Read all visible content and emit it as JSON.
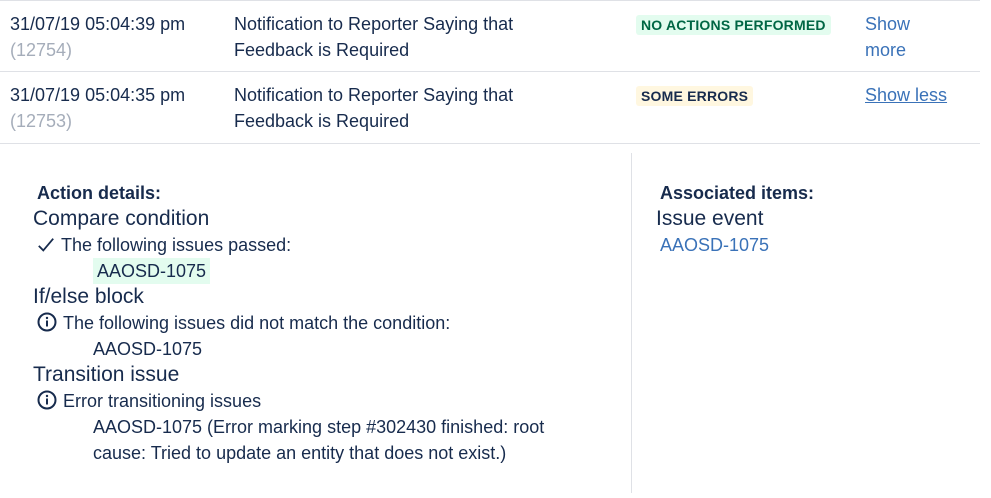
{
  "rows": [
    {
      "date": "31/07/19 05:04:39 pm",
      "id": "(12754)",
      "description": "Notification to Reporter Saying that Feedback is Required",
      "status": "NO ACTIONS PERFORMED",
      "toggle": "Show more",
      "status_color": "#006644"
    },
    {
      "date": "31/07/19 05:04:35 pm",
      "id": "(12753)",
      "description": "Notification to Reporter Saying that Feedback is Required",
      "status": "SOME ERRORS",
      "toggle": "Show less",
      "status_color": "#172b4d"
    }
  ],
  "action_details": {
    "heading": "Action details:",
    "compare": {
      "title": "Compare condition",
      "message": "The following issues passed:",
      "issue": "AAOSD-1075",
      "icon": "check-icon"
    },
    "ifelse": {
      "title": "If/else block",
      "message": "The following issues did not match the condition:",
      "issue": "AAOSD-1075",
      "icon": "info-icon"
    },
    "transition": {
      "title": "Transition issue",
      "message": "Error transitioning issues",
      "issue_line1": "AAOSD-1075 (Error marking step #302430 finished: root",
      "issue_line2": "cause: Tried to update an entity that does not exist.)",
      "icon": "info-icon"
    }
  },
  "associated": {
    "heading": "Associated items:",
    "title": "Issue event",
    "issue": "AAOSD-1075"
  },
  "colors": {
    "link": "#3a72b8",
    "success_bg": "#e3fcef",
    "muted": "#a5adba"
  }
}
